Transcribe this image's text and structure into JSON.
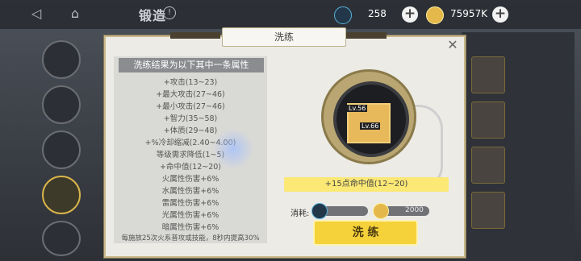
{
  "topbar": {
    "title": "锻造",
    "back_icon": "back-icon",
    "home_icon": "home-icon",
    "info_icon": "info-icon",
    "gem_value": "258",
    "gold_value": "75957K"
  },
  "modal": {
    "title": "洗练",
    "list_header": "洗练结果为以下其中一条属性",
    "attributes": [
      "+攻击(13~23)",
      "+最大攻击(27~46)",
      "+最小攻击(27~46)",
      "+智力(35~58)",
      "+体质(29~48)",
      "+%冷却缩减(2.40~4.00)",
      "等级需求降低(1~5)",
      "+命中值(12~20)",
      "火属性伤害+6%",
      "水属性伤害+6%",
      "雷属性伤害+6%",
      "光属性伤害+6%",
      "暗属性伤害+6%",
      "每施放25次火系普攻或技能，8秒内提高30%"
    ],
    "item_level_back": "Lv.56",
    "item_level_front": "Lv.66",
    "result_text": "+15点命中值(12~20)",
    "cost_label": "消耗:",
    "gold_cost": "2000",
    "refine_button": "洗 练"
  },
  "colors": {
    "accent": "#f6d23a",
    "result_bg": "#fbe875",
    "modal_bg": "#ecebe6"
  }
}
